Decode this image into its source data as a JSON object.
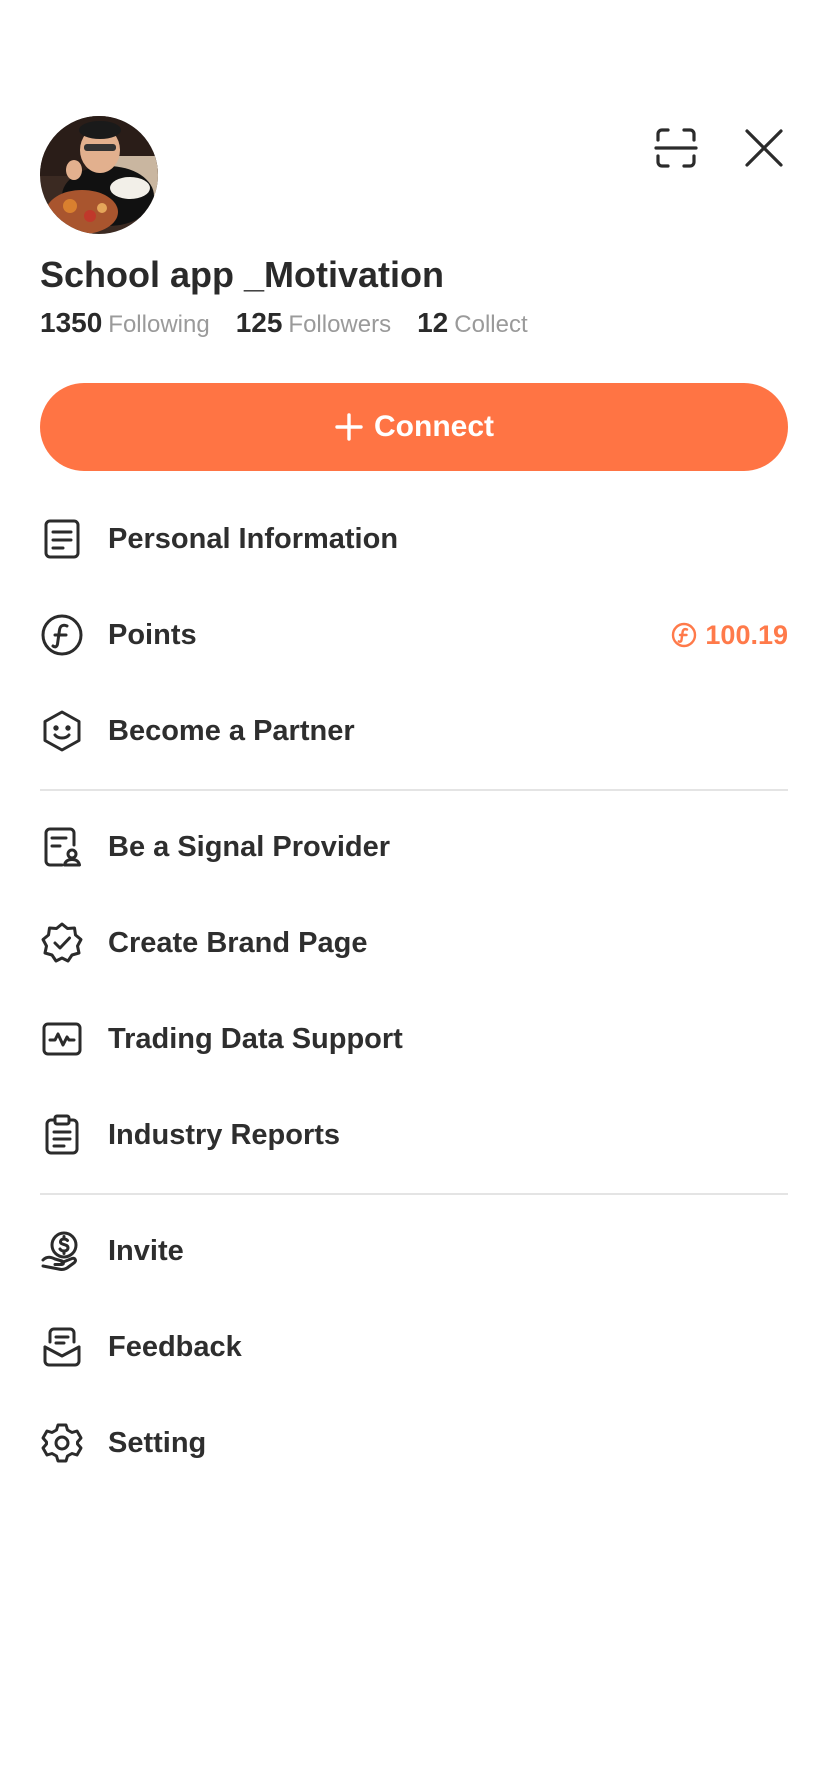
{
  "profile": {
    "name": "School app _Motivation",
    "following_count": "1350",
    "following_label": "Following",
    "followers_count": "125",
    "followers_label": "Followers",
    "collect_count": "12",
    "collect_label": "Collect"
  },
  "connect_label": "Connect",
  "menu": {
    "personal_info": "Personal Information",
    "points": "Points",
    "points_value": "100.19",
    "partner": "Become a Partner",
    "signal_provider": "Be a Signal Provider",
    "brand_page": "Create Brand Page",
    "trading_data": "Trading Data Support",
    "industry_reports": "Industry Reports",
    "invite": "Invite",
    "feedback": "Feedback",
    "setting": "Setting"
  },
  "colors": {
    "accent": "#ff7444",
    "text": "#2e2e2e",
    "muted": "#9a9a9a",
    "divider": "#e4e4e4"
  },
  "icons": [
    "scan-icon",
    "close-icon",
    "plus-icon",
    "document-icon",
    "coin-icon",
    "smile-hexagon-icon",
    "profile-document-icon",
    "verified-badge-icon",
    "activity-chart-icon",
    "clipboard-icon",
    "money-hand-icon",
    "mail-box-icon",
    "gear-icon"
  ]
}
